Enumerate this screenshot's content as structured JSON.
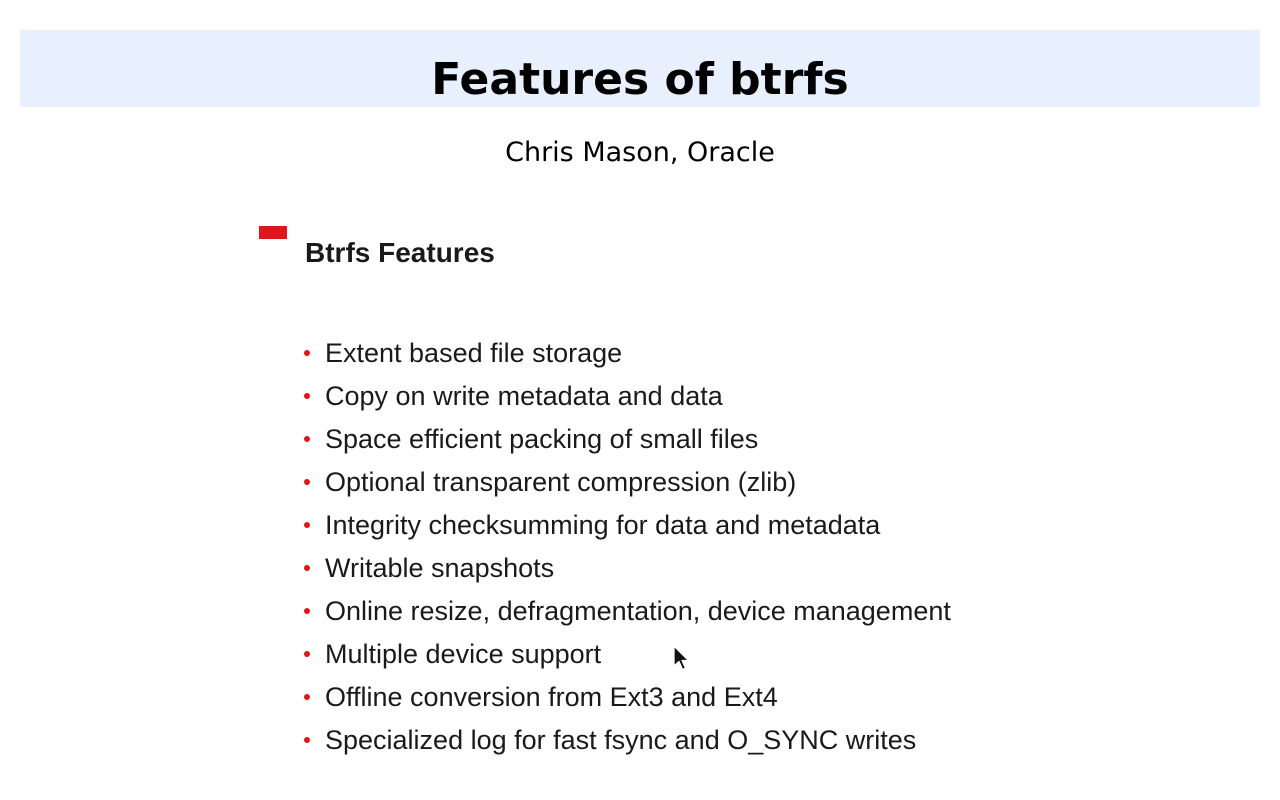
{
  "header": {
    "title": "Features of btrfs",
    "subtitle": "Chris Mason, Oracle"
  },
  "slide": {
    "heading": "Btrfs Features",
    "bullets": [
      "Extent based file storage",
      "Copy on write metadata and data",
      "Space efficient packing of small files",
      "Optional transparent compression (zlib)",
      "Integrity checksumming for data and metadata",
      "Writable snapshots",
      "Online resize, defragmentation, device management",
      "Multiple device support",
      "Offline conversion from Ext3 and Ext4",
      "Specialized log for fast fsync and O_SYNC writes"
    ]
  },
  "colors": {
    "title_band": "#e8effd",
    "accent_red": "#e0161c",
    "text": "#1a1a1a"
  },
  "icons": {
    "cursor": "mouse-pointer-icon",
    "marker": "red-bar-marker"
  }
}
